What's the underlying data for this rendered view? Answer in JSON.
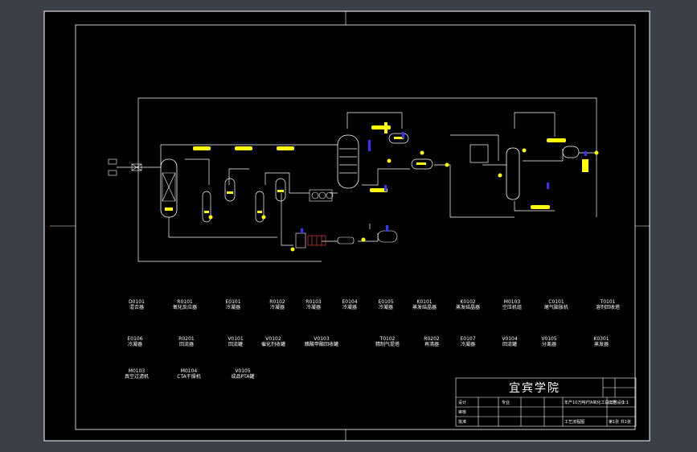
{
  "colors": {
    "background": "#3a3f48",
    "sheet": "#000000",
    "line": "#ffffff",
    "equipment": "#ffff00",
    "accent": "#3333ff",
    "highlight": "#ff4444"
  },
  "drawing": {
    "school": "宜宾学院",
    "equipment_row1": [
      {
        "code": "D0101",
        "name": "混合器"
      },
      {
        "code": "R0101",
        "name": "氧化反应器"
      },
      {
        "code": "E0101",
        "name": "冷凝器"
      },
      {
        "code": "R0102",
        "name": "冷凝器"
      },
      {
        "code": "R0103",
        "name": "冷凝器"
      },
      {
        "code": "E0104",
        "name": "冷凝器"
      },
      {
        "code": "E0105",
        "name": "冷凝器"
      },
      {
        "code": "K0101",
        "name": "蒸发结晶器"
      },
      {
        "code": "K0102",
        "name": "蒸发结晶器"
      },
      {
        "code": "M0103",
        "name": "空压机组"
      },
      {
        "code": "C0101",
        "name": "尾气膨胀机"
      },
      {
        "code": "T0101",
        "name": "溶剂回收塔"
      }
    ],
    "equipment_row2": [
      {
        "code": "E0106",
        "name": "冷凝器"
      },
      {
        "code": "R0201",
        "name": "回流器"
      },
      {
        "code": "V0101",
        "name": "回流罐"
      },
      {
        "code": "V0102",
        "name": "催化剂收罐"
      },
      {
        "code": "V0103",
        "name": "醋酸甲酯回收罐"
      },
      {
        "code": "T0102",
        "name": "精制气提塔"
      },
      {
        "code": "R0202",
        "name": "再沸器"
      },
      {
        "code": "E0107",
        "name": "冷凝器"
      },
      {
        "code": "V0104",
        "name": "回流罐"
      },
      {
        "code": "V0105",
        "name": "分离器"
      },
      {
        "code": "K0301",
        "name": "蒸发器"
      }
    ],
    "equipment_row3": [
      {
        "code": "M0103",
        "name": "真空过滤机"
      },
      {
        "code": "M0104",
        "name": "CTA干燥机"
      },
      {
        "code": "V0105",
        "name": "成品PTA罐"
      }
    ],
    "title_block": {
      "design": "设计",
      "check": "审核",
      "approve": "批准",
      "professional": "专业",
      "name_field": "年产10万吨PTA氧化工段工艺设计",
      "drawing_name": "工艺流程图",
      "scale_label": "比例",
      "scale_value": "1:1",
      "sheet_label": "第1张 共1张"
    }
  }
}
